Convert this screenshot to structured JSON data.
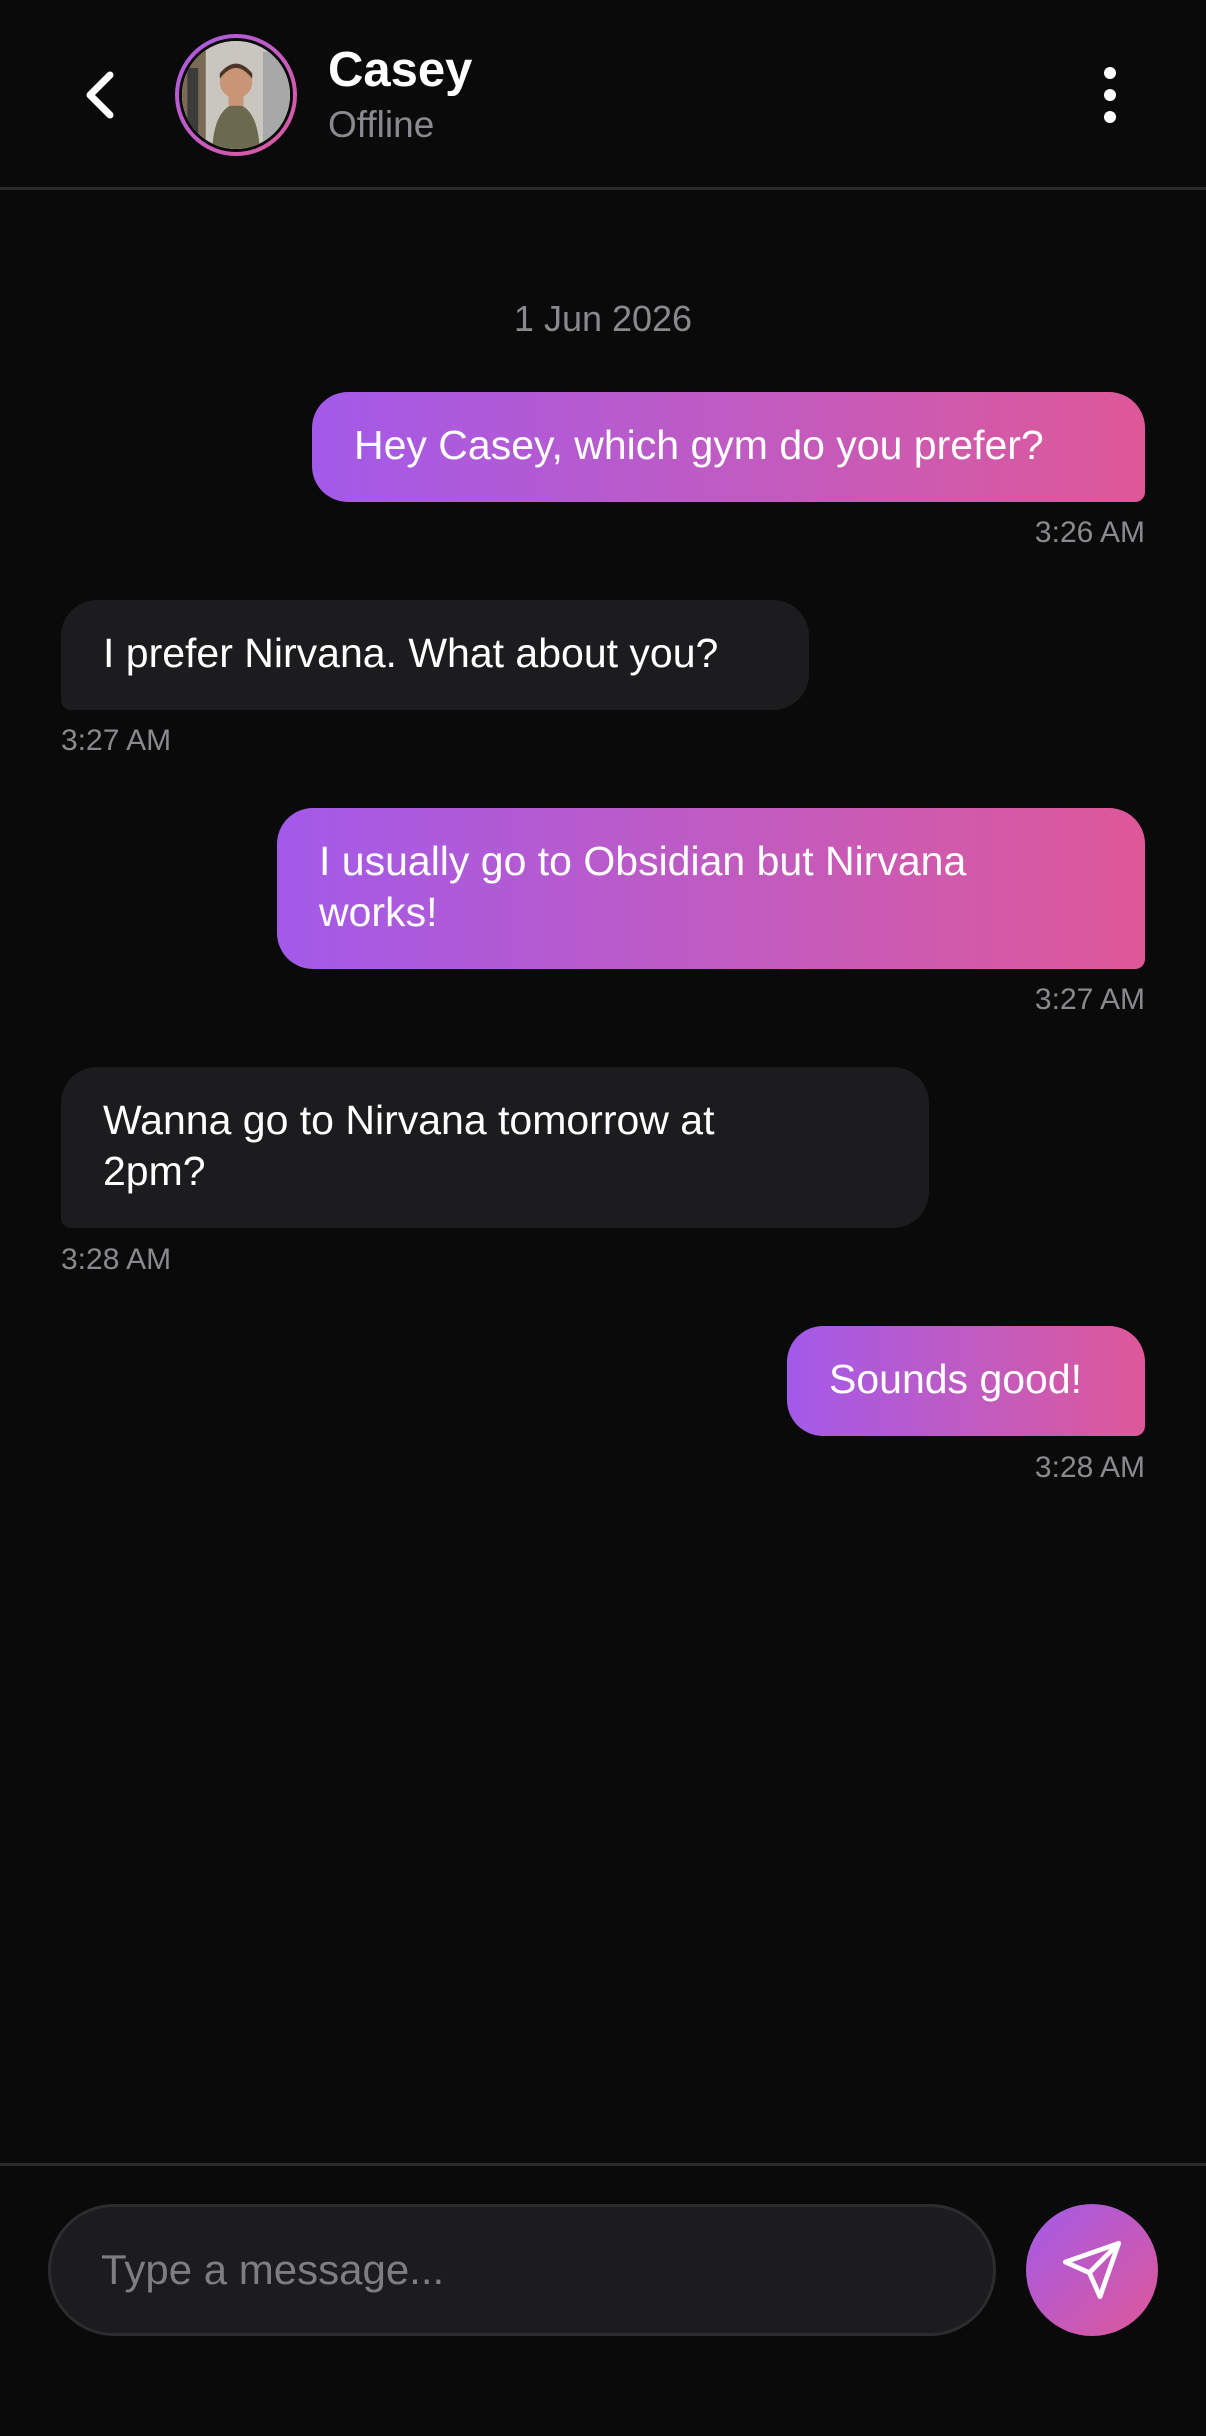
{
  "header": {
    "contact_name": "Casey",
    "contact_status": "Offline",
    "back_icon": "chevron-left-icon",
    "more_icon": "more-vertical-icon"
  },
  "chat": {
    "date_separator": "1 Jun 2026",
    "messages": [
      {
        "direction": "out",
        "text": "Hey Casey, which gym do you prefer?",
        "time": "3:26 AM"
      },
      {
        "direction": "in",
        "text": "I prefer Nirvana. What about you?",
        "time": "3:27 AM"
      },
      {
        "direction": "out",
        "text": "I usually go to Obsidian but Nirvana works!",
        "time": "3:27 AM"
      },
      {
        "direction": "in",
        "text": "Wanna go to Nirvana tomorrow at 2pm?",
        "time": "3:28 AM"
      },
      {
        "direction": "out",
        "text": "Sounds good!",
        "time": "3:28 AM"
      }
    ]
  },
  "composer": {
    "placeholder": "Type a message...",
    "send_icon": "send-icon"
  },
  "colors": {
    "background": "#0a0a0b",
    "incoming_bubble": "#1c1c1e",
    "gradient_start": "#a35ae9",
    "gradient_end": "#de5898",
    "muted_text": "#8a8a8e"
  }
}
